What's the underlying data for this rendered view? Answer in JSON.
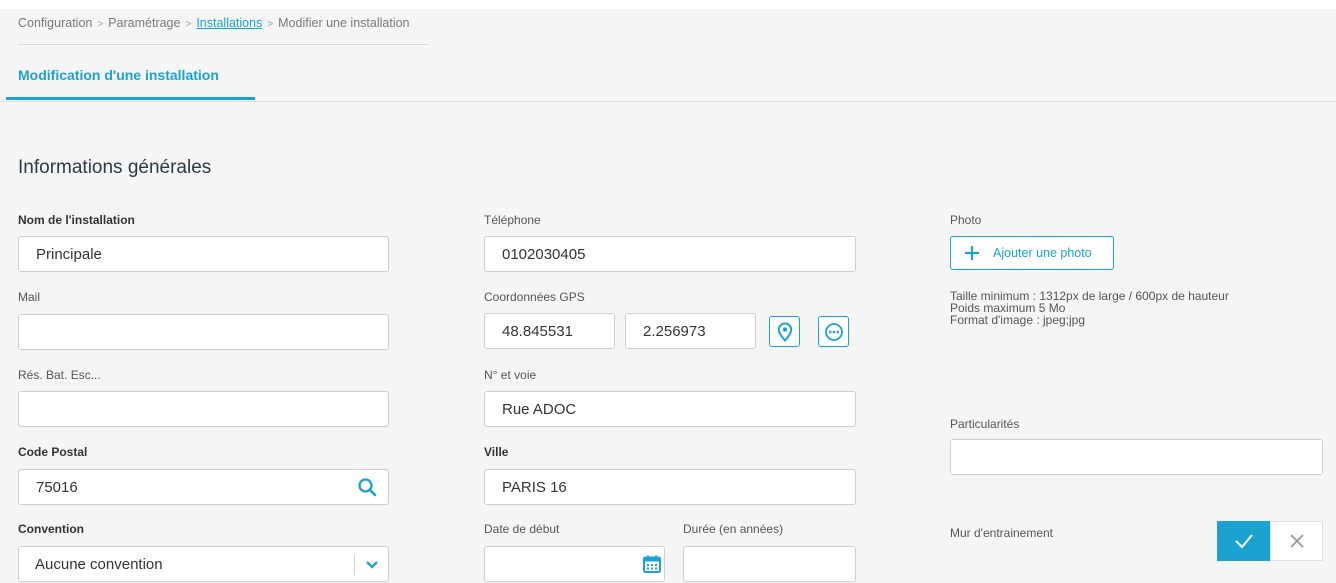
{
  "breadcrumb": {
    "items": [
      "Configuration",
      "Paramétrage",
      "Installations",
      "Modifier une installation"
    ],
    "separator": ">"
  },
  "tab": {
    "label": "Modification d'une installation"
  },
  "section": {
    "title": "Informations générales"
  },
  "form": {
    "nom": {
      "label": "Nom de l'installation",
      "value": "Principale"
    },
    "mail": {
      "label": "Mail",
      "value": ""
    },
    "res": {
      "label": "Rés. Bat. Esc...",
      "value": ""
    },
    "code_postal": {
      "label": "Code Postal",
      "value": "75016"
    },
    "convention": {
      "label": "Convention",
      "value": "Aucune convention"
    },
    "telephone": {
      "label": "Téléphone",
      "value": "0102030405"
    },
    "gps": {
      "label": "Coordonnées GPS",
      "lat": "48.845531",
      "lng": "2.256973"
    },
    "voie": {
      "label": "N° et voie",
      "value": "Rue ADOC"
    },
    "ville": {
      "label": "Ville",
      "value": "PARIS 16"
    },
    "date_debut": {
      "label": "Date de début",
      "value": ""
    },
    "duree": {
      "label": "Durée (en années)",
      "value": ""
    },
    "photo": {
      "label": "Photo",
      "add_label": "Ajouter une photo",
      "info": [
        "Taille minimum : 1312px de large / 600px de hauteur",
        "Poids maximum 5 Mo",
        "Format d'image : jpeg;jpg"
      ]
    },
    "particularites": {
      "label": "Particularités",
      "value": ""
    },
    "mur": {
      "label": "Mur d'entrainement"
    }
  },
  "colors": {
    "accent": "#1aa3d1",
    "title": "#2b3a48",
    "background": "#f5f5f5"
  },
  "icons": [
    "plus-icon",
    "map-pin-icon",
    "more-icon",
    "search-icon",
    "chevron-down-icon",
    "calendar-icon",
    "check-icon",
    "close-icon"
  ]
}
